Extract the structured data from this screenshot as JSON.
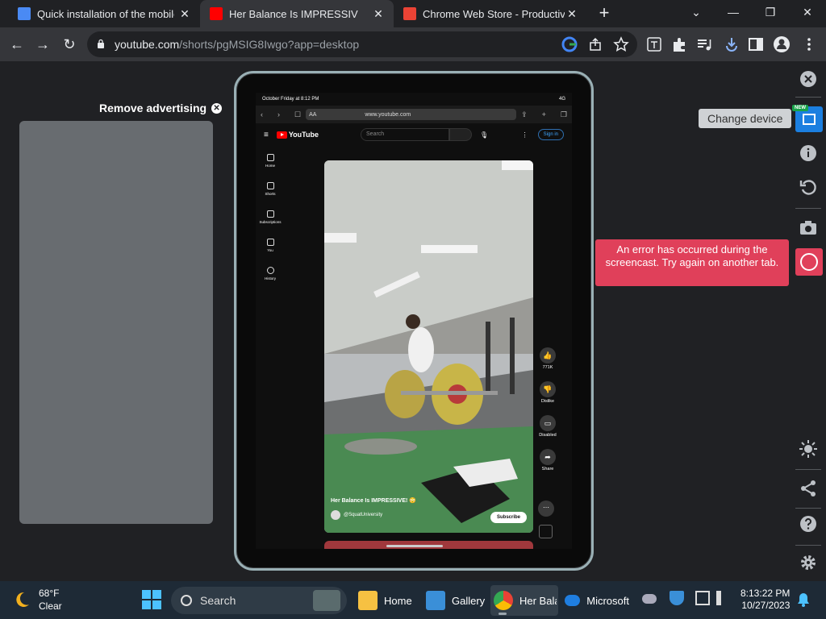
{
  "browser": {
    "tabs": [
      {
        "title": "Quick installation of the mobile simulator",
        "favicon": "doc-icon",
        "active": false
      },
      {
        "title": "Her Balance Is IMPRESSIVE!",
        "favicon": "youtube-icon",
        "active": true
      },
      {
        "title": "Chrome Web Store - Productivity",
        "favicon": "webstore-icon",
        "active": false
      }
    ],
    "new_tab": "+",
    "address": {
      "host": "youtube.com",
      "path": "/shorts/pgMSIG8Iwgo?app=desktop"
    }
  },
  "ad_panel": {
    "label": "Remove advertising"
  },
  "device": {
    "status_time": "October Friday at 8:12 PM",
    "status_right": "4G",
    "safari_aa": "AA",
    "safari_url": "www.youtube.com",
    "yt": {
      "logo": "YouTube",
      "search_placeholder": "Search",
      "sign_in": "Sign in",
      "sidebar": [
        "Home",
        "Shorts",
        "Subscriptions",
        "You",
        "History"
      ],
      "video_title": "Her Balance Is IMPRESSIVE! 😳",
      "channel": "@SquatUniversity",
      "subscribe": "Subscribe",
      "actions": [
        {
          "icon": "like-icon",
          "label": "771K"
        },
        {
          "icon": "dislike-icon",
          "label": "Dislike"
        },
        {
          "icon": "comments-icon",
          "label": "Disabled"
        },
        {
          "icon": "share-icon",
          "label": "Share"
        }
      ]
    }
  },
  "simulator": {
    "change_device_tooltip": "Change device",
    "new_badge": "NEW",
    "error_message": "An error has occurred during the screencast. Try again on another tab."
  },
  "taskbar": {
    "weather_temp": "68°F",
    "weather_desc": "Clear",
    "search_label": "Search",
    "apps": [
      {
        "label": "Home",
        "icon": "folder-icon"
      },
      {
        "label": "Gallery",
        "icon": "gallery-icon"
      },
      {
        "label": "Her Bala",
        "icon": "chrome-icon"
      },
      {
        "label": "Microsoft",
        "icon": "onedrive-icon"
      }
    ],
    "time": "8:13:22 PM",
    "date": "10/27/2023"
  },
  "colors": {
    "accent": "#1b7fe0",
    "error": "#e0405a",
    "yt_red": "#ff0000"
  }
}
